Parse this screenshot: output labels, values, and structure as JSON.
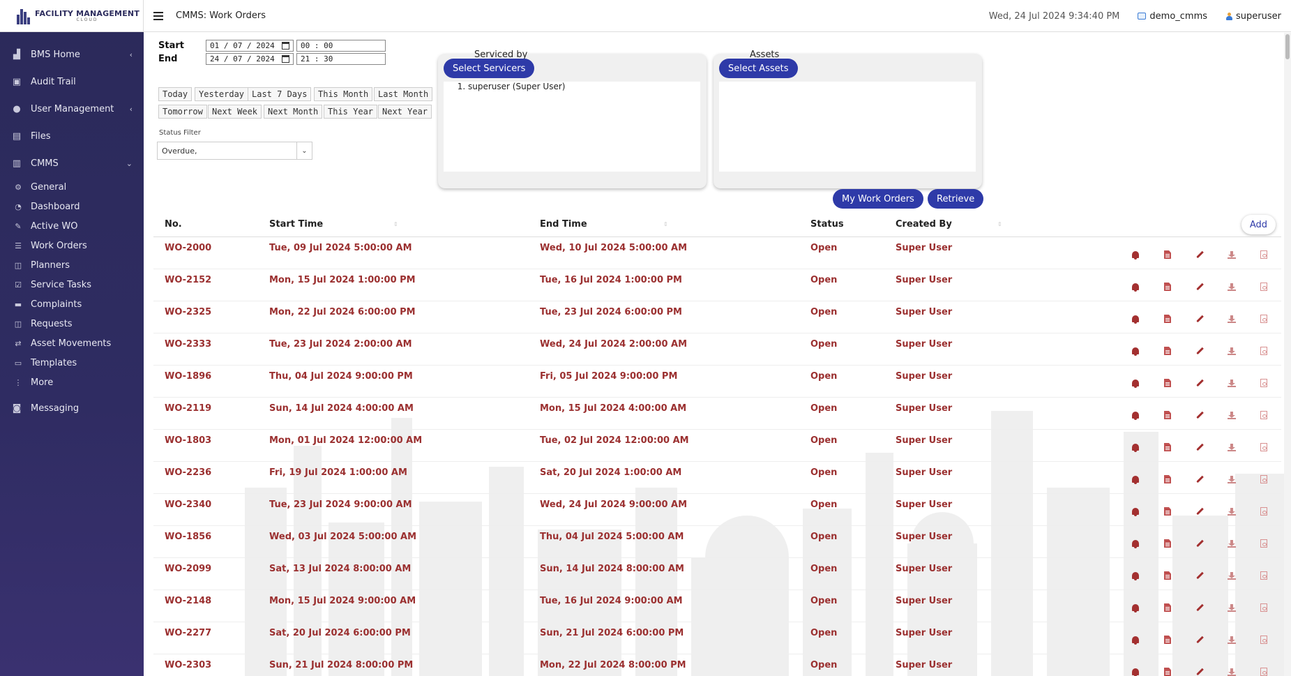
{
  "app": {
    "logo_title": "FACILITY MANAGEMENT",
    "logo_subtitle": "CLOUD"
  },
  "topbar": {
    "page_title": "CMMS: Work Orders",
    "datetime": "Wed, 24 Jul 2024 9:34:40 PM",
    "site": "demo_cmms",
    "user": "superuser"
  },
  "sidebar": {
    "items": [
      {
        "label": "BMS Home",
        "icon": "building-icon",
        "chevron": "chevron-left-icon"
      },
      {
        "label": "Audit Trail",
        "icon": "clipboard-icon"
      },
      {
        "label": "User Management",
        "icon": "users-icon",
        "chevron": "chevron-left-icon"
      },
      {
        "label": "Files",
        "icon": "files-icon"
      },
      {
        "label": "CMMS",
        "icon": "cmms-icon",
        "chevron": "chevron-down-icon"
      }
    ],
    "cmms_subitems": [
      {
        "label": "General",
        "icon": "cogs-icon"
      },
      {
        "label": "Dashboard",
        "icon": "dashboard-icon"
      },
      {
        "label": "Active WO",
        "icon": "wrench-icon"
      },
      {
        "label": "Work Orders",
        "icon": "list-icon"
      },
      {
        "label": "Planners",
        "icon": "planner-icon"
      },
      {
        "label": "Service Tasks",
        "icon": "check-square-icon"
      },
      {
        "label": "Complaints",
        "icon": "complaints-icon"
      },
      {
        "label": "Requests",
        "icon": "requests-icon"
      },
      {
        "label": "Asset Movements",
        "icon": "exchange-icon"
      },
      {
        "label": "Templates",
        "icon": "template-icon"
      },
      {
        "label": "More",
        "icon": "more-vertical-icon"
      }
    ],
    "messaging": {
      "label": "Messaging",
      "icon": "messaging-icon"
    }
  },
  "filters": {
    "start_label": "Start",
    "end_label": "End",
    "start_date": "01 / 07 / 2024",
    "start_time": "00 : 00",
    "end_date": "24 / 07 / 2024",
    "end_time": "21 : 30",
    "quick": [
      "Today",
      "Yesterday",
      "Last 7 Days",
      "This Month",
      "Last Month",
      "Tomorrow",
      "Next Week",
      "Next Month",
      "This Year",
      "Next Year"
    ],
    "status_label": "Status Filter",
    "status_value": "Overdue,"
  },
  "servicers": {
    "title": "Serviced by",
    "button": "Select Servicers",
    "items": [
      "superuser (Super User)"
    ]
  },
  "assets": {
    "title": "Assets",
    "button": "Select Assets"
  },
  "actions": {
    "my_work_orders": "My Work Orders",
    "retrieve": "Retrieve",
    "add": "Add"
  },
  "table": {
    "headers": [
      "No.",
      "Start Time",
      "End Time",
      "Status",
      "Created By"
    ],
    "rows": [
      [
        "WO-2000",
        "Tue, 09 Jul 2024 5:00:00 AM",
        "Wed, 10 Jul 2024 5:00:00 AM",
        "Open",
        "Super User"
      ],
      [
        "WO-2152",
        "Mon, 15 Jul 2024 1:00:00 PM",
        "Tue, 16 Jul 2024 1:00:00 PM",
        "Open",
        "Super User"
      ],
      [
        "WO-2325",
        "Mon, 22 Jul 2024 6:00:00 PM",
        "Tue, 23 Jul 2024 6:00:00 PM",
        "Open",
        "Super User"
      ],
      [
        "WO-2333",
        "Tue, 23 Jul 2024 2:00:00 AM",
        "Wed, 24 Jul 2024 2:00:00 AM",
        "Open",
        "Super User"
      ],
      [
        "WO-1896",
        "Thu, 04 Jul 2024 9:00:00 PM",
        "Fri, 05 Jul 2024 9:00:00 PM",
        "Open",
        "Super User"
      ],
      [
        "WO-2119",
        "Sun, 14 Jul 2024 4:00:00 AM",
        "Mon, 15 Jul 2024 4:00:00 AM",
        "Open",
        "Super User"
      ],
      [
        "WO-1803",
        "Mon, 01 Jul 2024 12:00:00 AM",
        "Tue, 02 Jul 2024 12:00:00 AM",
        "Open",
        "Super User"
      ],
      [
        "WO-2236",
        "Fri, 19 Jul 2024 1:00:00 AM",
        "Sat, 20 Jul 2024 1:00:00 AM",
        "Open",
        "Super User"
      ],
      [
        "WO-2340",
        "Tue, 23 Jul 2024 9:00:00 AM",
        "Wed, 24 Jul 2024 9:00:00 AM",
        "Open",
        "Super User"
      ],
      [
        "WO-1856",
        "Wed, 03 Jul 2024 5:00:00 AM",
        "Thu, 04 Jul 2024 5:00:00 AM",
        "Open",
        "Super User"
      ],
      [
        "WO-2099",
        "Sat, 13 Jul 2024 8:00:00 AM",
        "Sun, 14 Jul 2024 8:00:00 AM",
        "Open",
        "Super User"
      ],
      [
        "WO-2148",
        "Mon, 15 Jul 2024 9:00:00 AM",
        "Tue, 16 Jul 2024 9:00:00 AM",
        "Open",
        "Super User"
      ],
      [
        "WO-2277",
        "Sat, 20 Jul 2024 6:00:00 PM",
        "Sun, 21 Jul 2024 6:00:00 PM",
        "Open",
        "Super User"
      ],
      [
        "WO-2303",
        "Sun, 21 Jul 2024 8:00:00 PM",
        "Mon, 22 Jul 2024 8:00:00 PM",
        "Open",
        "Super User"
      ]
    ],
    "row_actions": [
      "bell-icon",
      "document-icon",
      "pencil-icon",
      "download-icon",
      "pdf-icon"
    ]
  },
  "colors": {
    "sidebar_bg": "#2b2a5a",
    "accent": "#2e3aa8",
    "row_text": "#9b3030"
  }
}
